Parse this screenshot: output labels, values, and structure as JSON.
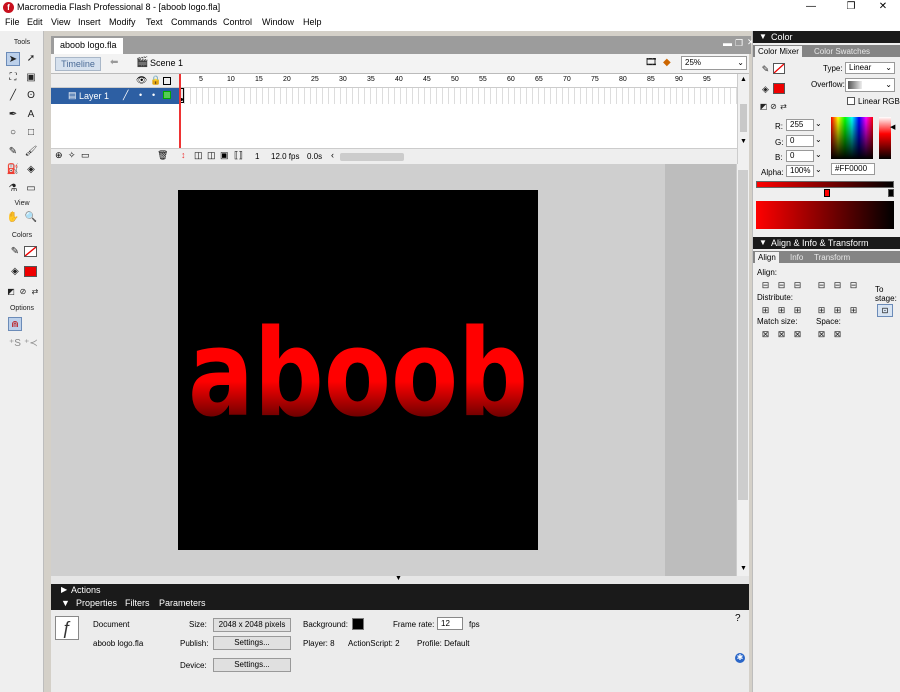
{
  "window": {
    "title": "Macromedia Flash Professional 8 - [aboob logo.fla]",
    "app_icon": "f"
  },
  "menu": [
    "File",
    "Edit",
    "View",
    "Insert",
    "Modify",
    "Text",
    "Commands",
    "Control",
    "Window",
    "Help"
  ],
  "tools": {
    "header": "Tools",
    "view_header": "View",
    "colors_header": "Colors",
    "options_header": "Options",
    "items": [
      {
        "name": "selection-tool-icon",
        "glyph": "➤"
      },
      {
        "name": "subselection-tool-icon",
        "glyph": "➚"
      },
      {
        "name": "free-transform-tool-icon",
        "glyph": "⛶"
      },
      {
        "name": "fill-transform-tool-icon",
        "glyph": "▣"
      },
      {
        "name": "line-tool-icon",
        "glyph": "╱"
      },
      {
        "name": "lasso-tool-icon",
        "glyph": "ʘ"
      },
      {
        "name": "pen-tool-icon",
        "glyph": "✒"
      },
      {
        "name": "text-tool-icon",
        "glyph": "A"
      },
      {
        "name": "oval-tool-icon",
        "glyph": "○"
      },
      {
        "name": "rectangle-tool-icon",
        "glyph": "□"
      },
      {
        "name": "pencil-tool-icon",
        "glyph": "✎"
      },
      {
        "name": "brush-tool-icon",
        "glyph": "🖌"
      },
      {
        "name": "ink-bottle-tool-icon",
        "glyph": "⛽"
      },
      {
        "name": "paint-bucket-tool-icon",
        "glyph": "◈"
      },
      {
        "name": "eyedropper-tool-icon",
        "glyph": "⚗"
      },
      {
        "name": "eraser-tool-icon",
        "glyph": "▭"
      }
    ],
    "view_items": [
      {
        "name": "hand-tool-icon",
        "glyph": "✋"
      },
      {
        "name": "zoom-tool-icon",
        "glyph": "🔍"
      }
    ]
  },
  "document": {
    "tab": "aboob logo.fla",
    "scene": "Scene 1",
    "timeline_label": "Timeline",
    "zoom": "25%",
    "layer": "Layer 1",
    "frame_numbers": [
      "5",
      "10",
      "15",
      "20",
      "25",
      "30",
      "35",
      "40",
      "45",
      "50",
      "55",
      "60",
      "65",
      "70",
      "75",
      "80",
      "85",
      "90",
      "95"
    ],
    "current_frame": "1",
    "fps": "12.0 fps",
    "time": "0.0s",
    "stage_text": "aboob",
    "stage_bg": "#000000",
    "gradient_colors": [
      "#ff0000",
      "#000000"
    ]
  },
  "actions": {
    "label": "Actions"
  },
  "properties": {
    "tabs": [
      "Properties",
      "Filters",
      "Parameters"
    ],
    "doc_type": "Document",
    "doc_name": "aboob logo.fla",
    "size_label": "Size:",
    "size_value": "2048 x 2048 pixels",
    "background_label": "Background:",
    "frame_rate_label": "Frame rate:",
    "frame_rate_value": "12",
    "fps_label": "fps",
    "publish_label": "Publish:",
    "settings_button": "Settings...",
    "player_text": "Player: 8",
    "actionscript_text": "ActionScript: 2",
    "profile_text": "Profile: Default",
    "device_label": "Device:",
    "device_settings_button": "Settings..."
  },
  "color_panel": {
    "title": "Color",
    "tabs": [
      "Color Mixer",
      "Color Swatches"
    ],
    "type_label": "Type:",
    "type_value": "Linear",
    "overflow_label": "Overflow:",
    "linear_rgb_label": "Linear RGB",
    "r_label": "R:",
    "r_value": "255",
    "g_label": "G:",
    "g_value": "0",
    "b_label": "B:",
    "b_value": "0",
    "alpha_label": "Alpha:",
    "alpha_value": "100%",
    "hex_value": "#FF0000"
  },
  "align_panel": {
    "title": "Align & Info & Transform",
    "tabs": [
      "Align",
      "Info",
      "Transform"
    ],
    "align_label": "Align:",
    "distribute_label": "Distribute:",
    "match_size_label": "Match size:",
    "space_label": "Space:",
    "to_stage_label": "To\nstage:"
  }
}
